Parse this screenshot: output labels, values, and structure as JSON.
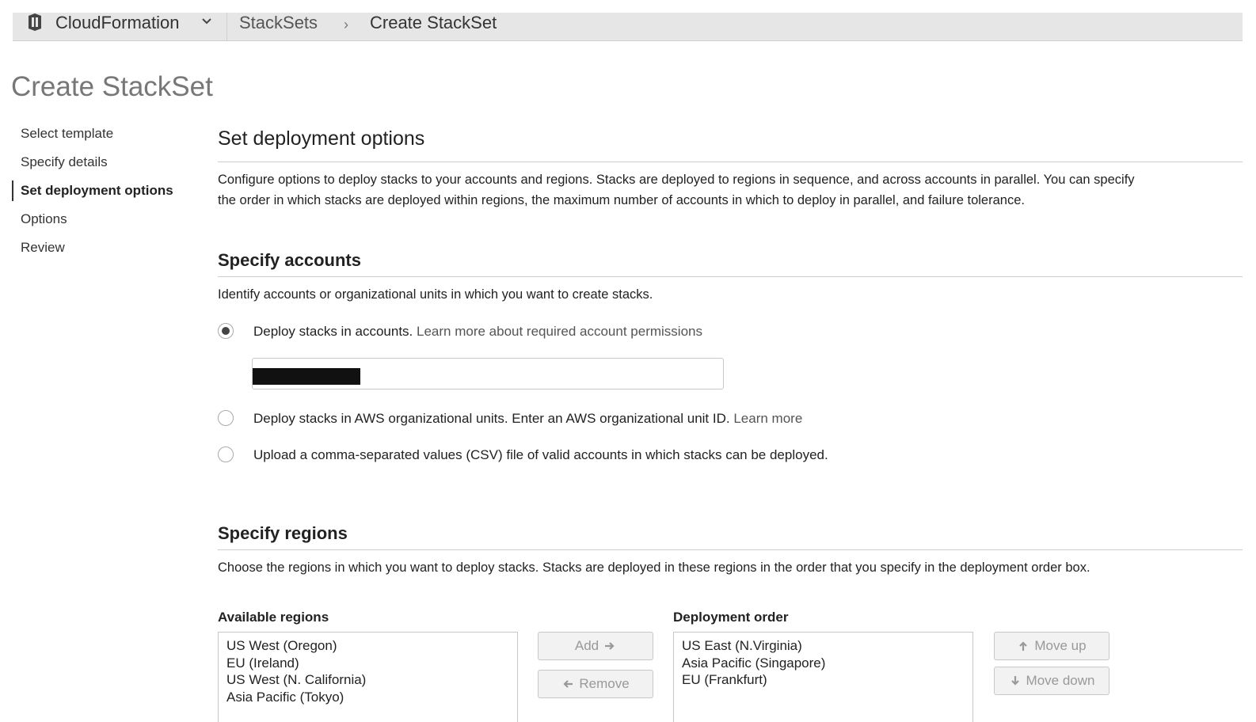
{
  "topbar": {
    "service": "CloudFormation",
    "breadcrumb": [
      "StackSets",
      "Create StackSet"
    ],
    "breadcrumb_separator": "›"
  },
  "page": {
    "title": "Create StackSet"
  },
  "sidebar": {
    "items": [
      {
        "label": "Select template",
        "active": false
      },
      {
        "label": "Specify details",
        "active": false
      },
      {
        "label": "Set deployment options",
        "active": true
      },
      {
        "label": "Options",
        "active": false
      },
      {
        "label": "Review",
        "active": false
      }
    ]
  },
  "main": {
    "title": "Set deployment options",
    "description_line1": "Configure options to deploy stacks to your accounts and regions. Stacks are deployed to regions in sequence, and across accounts in parallel. You can specify",
    "description_line2": "the order in which stacks are deployed within regions, the maximum number of accounts in which to deploy in parallel, and failure tolerance.",
    "accounts": {
      "title": "Specify accounts",
      "description": "Identify accounts or organizational units in which you want to create stacks.",
      "options": [
        {
          "text": "Deploy stacks in accounts.",
          "link": "Learn more about required account permissions",
          "selected": true
        },
        {
          "text": "Deploy stacks in AWS organizational units. Enter an AWS organizational unit ID.",
          "link": "Learn more",
          "selected": false
        },
        {
          "text": "Upload a comma-separated values (CSV) file of valid accounts in which stacks can be deployed.",
          "link": "",
          "selected": false
        }
      ]
    },
    "regions": {
      "title": "Specify regions",
      "description": "Choose the regions in which you want to deploy stacks. Stacks are deployed in these regions in the order that you specify in the deployment order box.",
      "available_label": "Available regions",
      "available": [
        "US West (Oregon)",
        "EU (Ireland)",
        "US West (N. California)",
        "Asia Pacific (Tokyo)"
      ],
      "order_label": "Deployment order",
      "order": [
        "US East (N.Virginia)",
        "Asia Pacific (Singapore)",
        "EU (Frankfurt)"
      ],
      "buttons": {
        "add": "Add",
        "remove": "Remove",
        "move_up": "Move up",
        "move_down": "Move down"
      }
    }
  }
}
